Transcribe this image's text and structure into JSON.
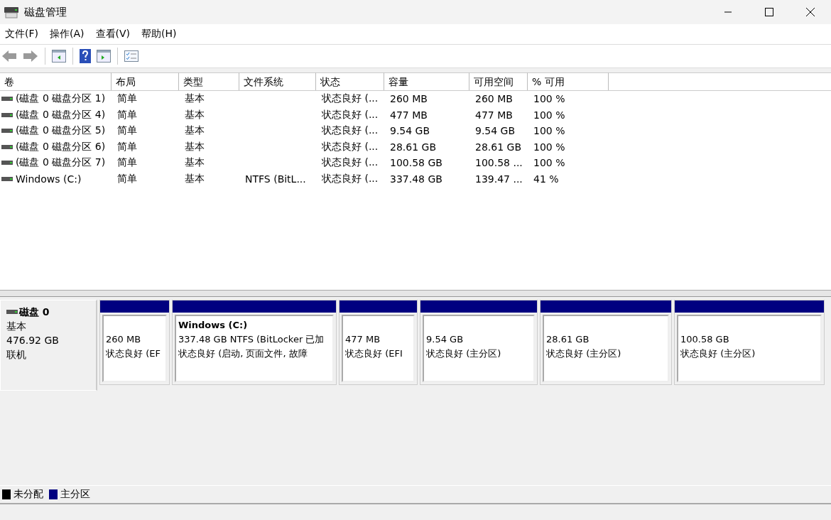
{
  "window": {
    "title": "磁盘管理"
  },
  "menu": [
    "文件(F)",
    "操作(A)",
    "查看(V)",
    "帮助(H)"
  ],
  "toolbar": [
    {
      "kind": "back",
      "disabled": true
    },
    {
      "kind": "forward",
      "disabled": true
    },
    {
      "kind": "sep"
    },
    {
      "kind": "panel-left"
    },
    {
      "kind": "sep"
    },
    {
      "kind": "help"
    },
    {
      "kind": "panel-right"
    },
    {
      "kind": "sep"
    },
    {
      "kind": "list"
    }
  ],
  "table": {
    "columns": [
      "卷",
      "布局",
      "类型",
      "文件系统",
      "状态",
      "容量",
      "可用空间",
      "% 可用"
    ],
    "rows": [
      [
        "(磁盘 0 磁盘分区 1)",
        "简单",
        "基本",
        "",
        "状态良好 (...",
        "260 MB",
        "260 MB",
        "100 %"
      ],
      [
        "(磁盘 0 磁盘分区 4)",
        "简单",
        "基本",
        "",
        "状态良好 (...",
        "477 MB",
        "477 MB",
        "100 %"
      ],
      [
        "(磁盘 0 磁盘分区 5)",
        "简单",
        "基本",
        "",
        "状态良好 (...",
        "9.54 GB",
        "9.54 GB",
        "100 %"
      ],
      [
        "(磁盘 0 磁盘分区 6)",
        "简单",
        "基本",
        "",
        "状态良好 (...",
        "28.61 GB",
        "28.61 GB",
        "100 %"
      ],
      [
        "(磁盘 0 磁盘分区 7)",
        "简单",
        "基本",
        "",
        "状态良好 (...",
        "100.58 GB",
        "100.58 ...",
        "100 %"
      ],
      [
        "Windows (C:)",
        "简单",
        "基本",
        "NTFS (BitL...",
        "状态良好 (...",
        "337.48 GB",
        "139.47 ...",
        "41 %"
      ]
    ]
  },
  "disk": {
    "name": "磁盘 0",
    "type": "基本",
    "size": "476.92 GB",
    "status": "联机",
    "partitions": [
      {
        "size": "260 MB",
        "status": "状态良好 (EF",
        "color": "#000080"
      },
      {
        "label": "Windows  (C:)",
        "size": "337.48 GB NTFS (BitLocker 已加",
        "status": "状态良好 (启动, 页面文件, 故障",
        "color": "#000080"
      },
      {
        "size": "477 MB",
        "status": "状态良好 (EFI",
        "color": "#000080"
      },
      {
        "size": "9.54 GB",
        "status": "状态良好 (主分区)",
        "color": "#000080"
      },
      {
        "size": "28.61 GB",
        "status": "状态良好 (主分区)",
        "color": "#000080"
      },
      {
        "size": "100.58 GB",
        "status": "状态良好 (主分区)",
        "color": "#000080"
      }
    ]
  },
  "legend": [
    {
      "label": "未分配",
      "color": "#000000"
    },
    {
      "label": "主分区",
      "color": "#000080"
    }
  ]
}
